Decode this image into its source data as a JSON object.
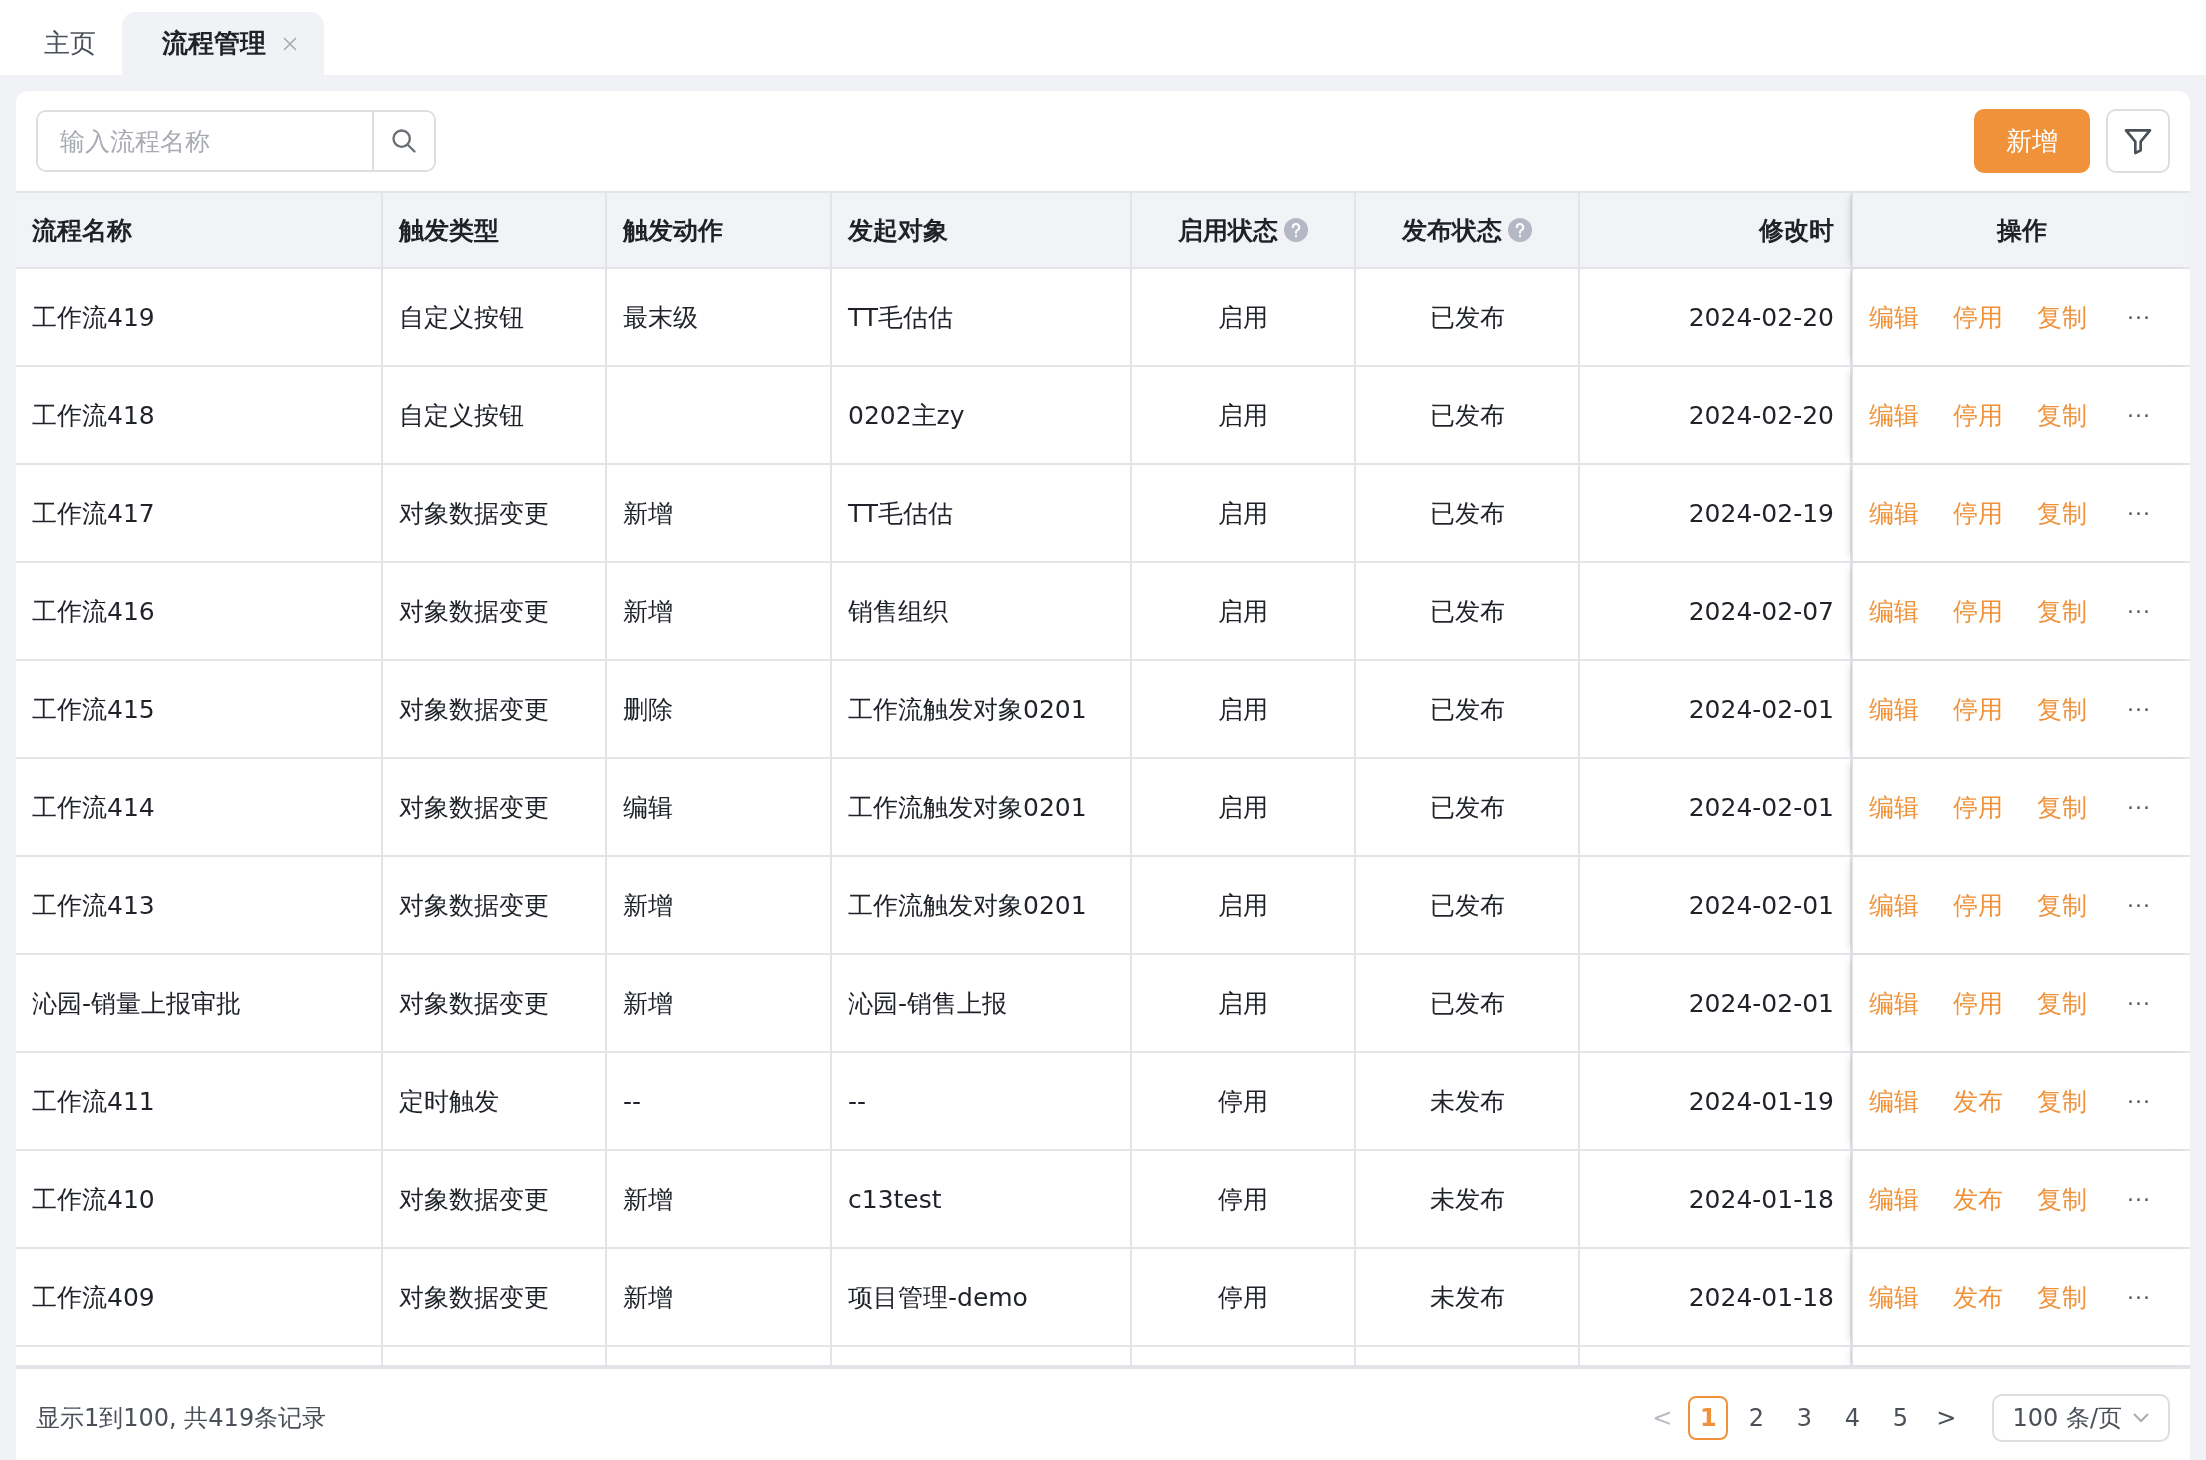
{
  "tabs": [
    {
      "label": "主页",
      "selected": false,
      "closable": false
    },
    {
      "label": "流程管理",
      "selected": true,
      "closable": true
    }
  ],
  "search": {
    "placeholder": "输入流程名称"
  },
  "add_button": "新增",
  "table": {
    "columns": [
      {
        "label": "流程名称",
        "help": false
      },
      {
        "label": "触发类型",
        "help": false
      },
      {
        "label": "触发动作",
        "help": false
      },
      {
        "label": "发起对象",
        "help": false
      },
      {
        "label": "启用状态",
        "help": true
      },
      {
        "label": "发布状态",
        "help": true
      },
      {
        "label": "修改时",
        "help": false
      }
    ],
    "action_column": "操作",
    "rows": [
      {
        "cells": [
          "工作流419",
          "自定义按钮",
          "最末级",
          "TT毛估估",
          "启用",
          "已发布",
          "2024-02-20"
        ],
        "actions": [
          "编辑",
          "停用",
          "复制"
        ],
        "more": "···"
      },
      {
        "cells": [
          "工作流418",
          "自定义按钮",
          "",
          "0202主zy",
          "启用",
          "已发布",
          "2024-02-20"
        ],
        "actions": [
          "编辑",
          "停用",
          "复制"
        ],
        "more": "···"
      },
      {
        "cells": [
          "工作流417",
          "对象数据变更",
          "新增",
          "TT毛估估",
          "启用",
          "已发布",
          "2024-02-19"
        ],
        "actions": [
          "编辑",
          "停用",
          "复制"
        ],
        "more": "···"
      },
      {
        "cells": [
          "工作流416",
          "对象数据变更",
          "新增",
          "销售组织",
          "启用",
          "已发布",
          "2024-02-07"
        ],
        "actions": [
          "编辑",
          "停用",
          "复制"
        ],
        "more": "···"
      },
      {
        "cells": [
          "工作流415",
          "对象数据变更",
          "删除",
          "工作流触发对象0201",
          "启用",
          "已发布",
          "2024-02-01"
        ],
        "actions": [
          "编辑",
          "停用",
          "复制"
        ],
        "more": "···"
      },
      {
        "cells": [
          "工作流414",
          "对象数据变更",
          "编辑",
          "工作流触发对象0201",
          "启用",
          "已发布",
          "2024-02-01"
        ],
        "actions": [
          "编辑",
          "停用",
          "复制"
        ],
        "more": "···"
      },
      {
        "cells": [
          "工作流413",
          "对象数据变更",
          "新增",
          "工作流触发对象0201",
          "启用",
          "已发布",
          "2024-02-01"
        ],
        "actions": [
          "编辑",
          "停用",
          "复制"
        ],
        "more": "···"
      },
      {
        "cells": [
          "沁园-销量上报审批",
          "对象数据变更",
          "新增",
          "沁园-销售上报",
          "启用",
          "已发布",
          "2024-02-01"
        ],
        "actions": [
          "编辑",
          "停用",
          "复制"
        ],
        "more": "···"
      },
      {
        "cells": [
          "工作流411",
          "定时触发",
          "--",
          "--",
          "停用",
          "未发布",
          "2024-01-19"
        ],
        "actions": [
          "编辑",
          "发布",
          "复制"
        ],
        "more": "···"
      },
      {
        "cells": [
          "工作流410",
          "对象数据变更",
          "新增",
          "c13test",
          "停用",
          "未发布",
          "2024-01-18"
        ],
        "actions": [
          "编辑",
          "发布",
          "复制"
        ],
        "more": "···"
      },
      {
        "cells": [
          "工作流409",
          "对象数据变更",
          "新增",
          "项目管理-demo",
          "停用",
          "未发布",
          "2024-01-18"
        ],
        "actions": [
          "编辑",
          "发布",
          "复制"
        ],
        "more": "···"
      }
    ]
  },
  "footer": {
    "summary": "显示1到100, 共419条记录",
    "prev": "<",
    "next": ">",
    "pages": [
      {
        "label": "1",
        "selected": true
      },
      {
        "label": "2",
        "selected": false
      },
      {
        "label": "3",
        "selected": false
      },
      {
        "label": "4",
        "selected": false
      },
      {
        "label": "5",
        "selected": false
      }
    ],
    "page_size": "100 条/页"
  }
}
